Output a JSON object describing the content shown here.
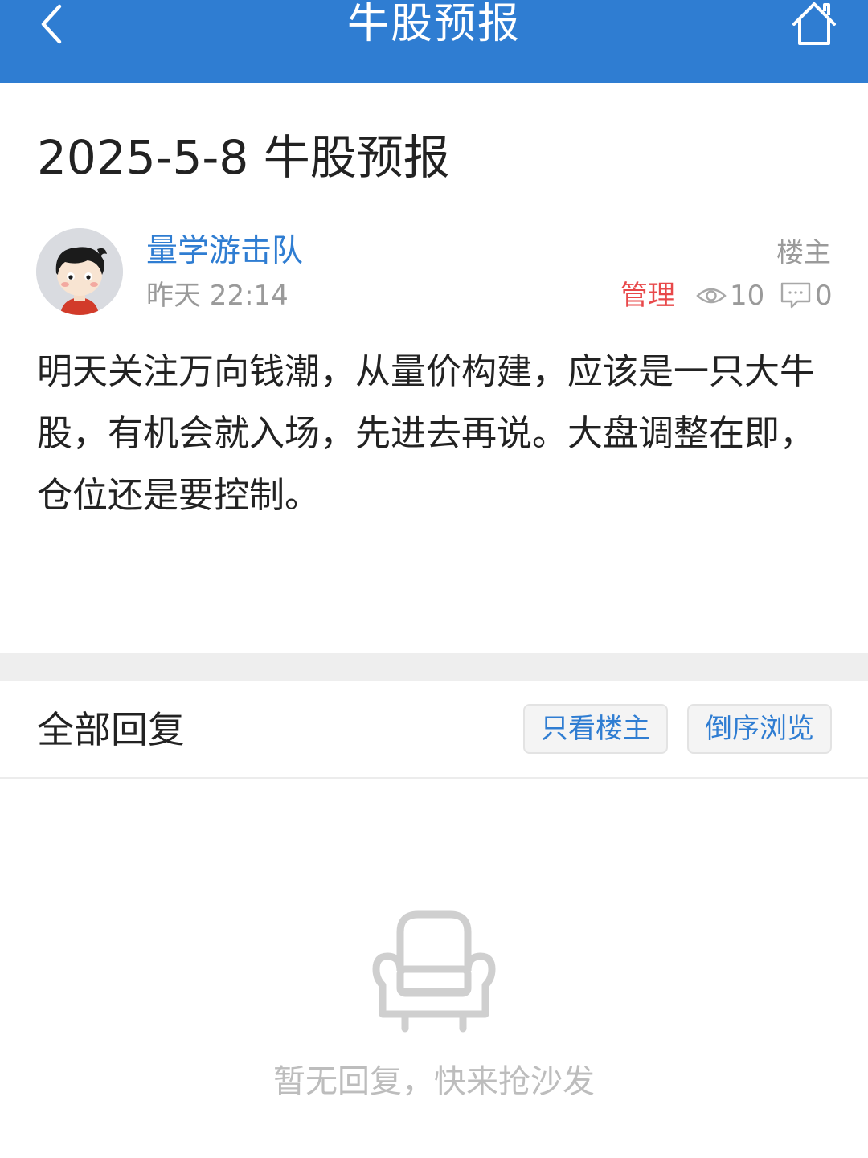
{
  "header": {
    "title": "牛股预报",
    "back_icon": "chevron-left-icon",
    "home_icon": "home-icon",
    "background_color": "#2f7dd2"
  },
  "post": {
    "title": "2025-5-8 牛股预报",
    "author": {
      "name": "量学游击队",
      "avatar_icon": "cartoon-boy-avatar"
    },
    "time": "昨天  22:14",
    "op_badge": "楼主",
    "manage_label": "管理",
    "views": "10",
    "comments": "0",
    "body": "明天关注万向钱潮，从量价构建，应该是一只大牛股，有机会就入场，先进去再说。大盘调整在即，仓位还是要控制。"
  },
  "replies": {
    "title": "全部回复",
    "filter_op_label": "只看楼主",
    "reverse_label": "倒序浏览",
    "empty_icon": "sofa-icon",
    "empty_text": "暂无回复，快来抢沙发"
  },
  "colors": {
    "accent": "#2f7dd2",
    "manage": "#e8484a",
    "muted": "#9a9a9a"
  }
}
